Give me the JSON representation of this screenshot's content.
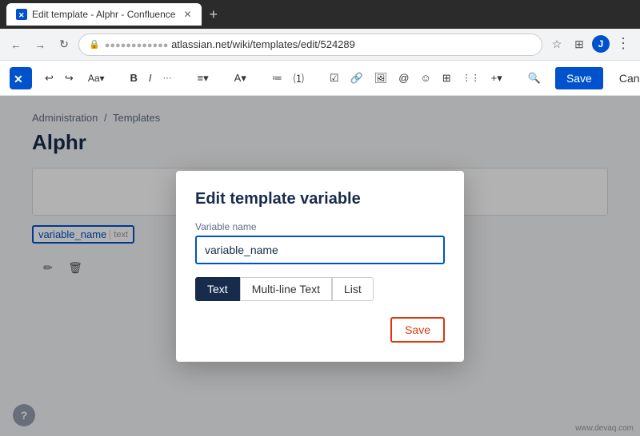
{
  "browser": {
    "tab_title": "Edit template - Alphr - Confluence",
    "url_display": "atlassian.net/wiki/templates/edit/524289",
    "url_prefix": "●●●●●●●●●●●●",
    "new_tab_label": "+"
  },
  "nav": {
    "back": "‹",
    "forward": "›",
    "refresh": "↻"
  },
  "toolbar": {
    "save_label": "Save",
    "cancel_label": "Cancel",
    "undo_icon": "↩",
    "redo_icon": "↪",
    "font_icon": "Aa",
    "bold_label": "B",
    "italic_label": "I",
    "more_label": "···",
    "align_icon": "≡",
    "text_color_icon": "A",
    "bullet_list_icon": "≔",
    "numbered_list_icon": "⑴",
    "check_icon": "✓",
    "link_icon": "🔗",
    "image_icon": "🖼",
    "at_icon": "@",
    "emoji_icon": "☺",
    "table_icon": "⊞",
    "columns_icon": "⋮⋮",
    "insert_icon": "+",
    "search_icon": "🔍",
    "more_dots": "···"
  },
  "breadcrumb": {
    "part1": "Administration",
    "separator": "/",
    "part2": "Templates"
  },
  "page": {
    "title": "Alphr"
  },
  "variable_chip": {
    "name": "variable_name",
    "type_label": "text"
  },
  "modal": {
    "title": "Edit template variable",
    "variable_name_label": "Variable name",
    "variable_name_value": "variable_name",
    "type_buttons": [
      {
        "label": "Text",
        "active": true
      },
      {
        "label": "Multi-line Text",
        "active": false
      },
      {
        "label": "List",
        "active": false
      }
    ],
    "save_label": "Save"
  },
  "help": {
    "icon": "?"
  },
  "watermark": "www.devaq.com"
}
